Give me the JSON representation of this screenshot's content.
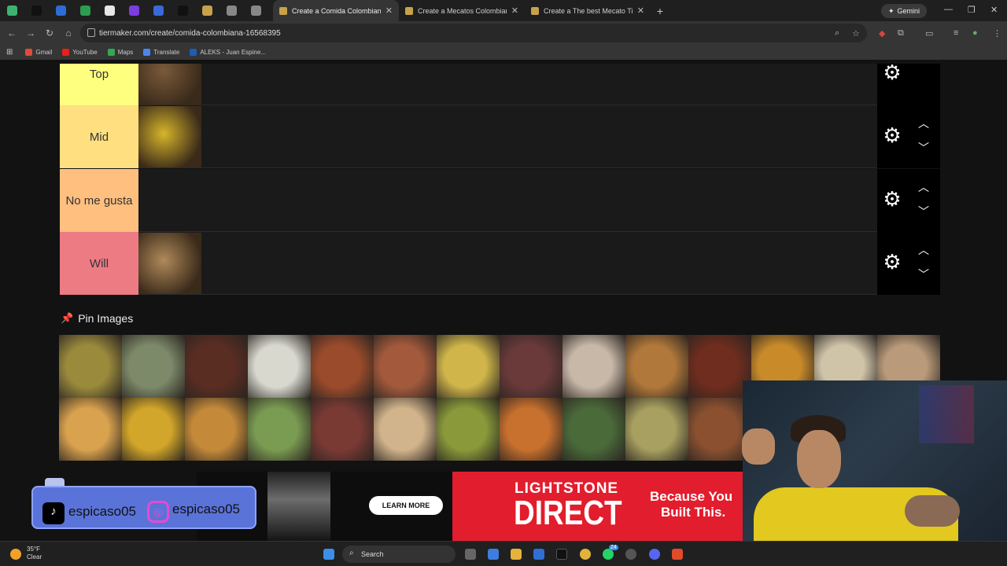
{
  "browser": {
    "pinned_tab_colors": [
      "#3cb371",
      "#111111",
      "#2d6bd6",
      "#2e9b4f",
      "#e7e7e7",
      "#7d3ce0",
      "#3a6ad8",
      "#111111",
      "#c8a24a",
      "#888888",
      "#888888"
    ],
    "tabs": [
      {
        "title": "Create a Comida Colombiana Ti",
        "active": true
      },
      {
        "title": "Create a Mecatos Colombianos",
        "active": false
      },
      {
        "title": "Create a The best Mecato Tier l",
        "active": false
      }
    ],
    "new_tab": "+",
    "gemini_label": "Gemini",
    "url": "tiermaker.com/create/comida-colombiana-16568395",
    "bookmarks": [
      {
        "label": "Gmail",
        "color": "#e04a3a"
      },
      {
        "label": "YouTube",
        "color": "#e62117"
      },
      {
        "label": "Maps",
        "color": "#34a853"
      },
      {
        "label": "Translate",
        "color": "#4a86f0"
      },
      {
        "label": "ALEKS - Juan Espine...",
        "color": "#1a5fb4"
      }
    ]
  },
  "tierlist": {
    "tiers": [
      {
        "label": "Top",
        "color": "#ffff7f",
        "image": "grilled meat plate"
      },
      {
        "label": "Mid",
        "color": "#ffdf7f",
        "image": "yellow rice"
      },
      {
        "label": "No me gusta",
        "color": "#ffbf7f",
        "image": ""
      },
      {
        "label": "Will",
        "color": "#ed7b84",
        "image": "arepas"
      }
    ],
    "pin_images_label": "Pin Images",
    "pool_colors": [
      [
        "#9a8a3c",
        "#7d8a6a",
        "#5a2d22",
        "#d8d8cf",
        "#9a4b2b",
        "#a35a3c",
        "#cfb54a",
        "#6a3a3a",
        "#c8b8a8",
        "#b0783a",
        "#6e2d1e",
        "#c98b2a",
        "#d0c4a8",
        "#b99a7a"
      ],
      [
        "#d9a24e",
        "#d2a62a",
        "#c48a3a",
        "#7a9b52",
        "#7a3a34",
        "#d2b48c",
        "#8a9a3a",
        "#c8702e",
        "#4a6a3a",
        "#a8a060",
        "#8a5030"
      ]
    ]
  },
  "ad": {
    "cta": "LEARN MORE",
    "brand_top": "LIGHTSTONE",
    "brand_bottom": "DIRECT",
    "tagline_1": "Because You",
    "tagline_2": "Built This."
  },
  "stream": {
    "tiktok_handle": "espicaso05",
    "instagram_handle": "espicaso05"
  },
  "taskbar": {
    "temperature": "35°F",
    "condition": "Clear",
    "search_placeholder": "Search",
    "badge_count": "24"
  }
}
